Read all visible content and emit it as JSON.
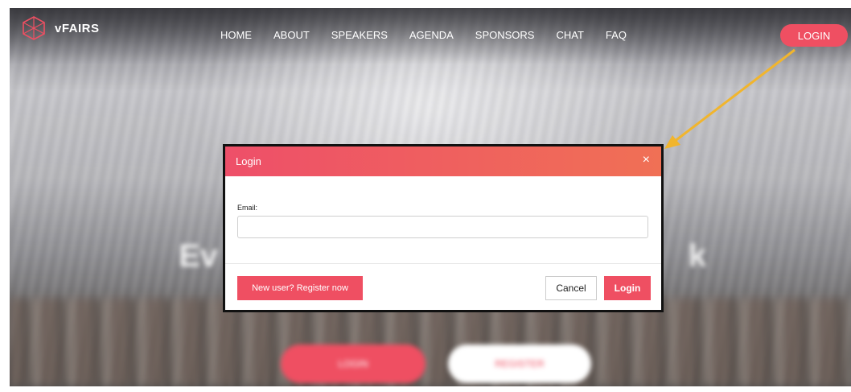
{
  "brand": {
    "name": "vFAIRS"
  },
  "nav": {
    "items": [
      "HOME",
      "ABOUT",
      "SPEAKERS",
      "AGENDA",
      "SPONSORS",
      "CHAT",
      "FAQ"
    ],
    "login_label": "LOGIN"
  },
  "hero": {
    "title_left": "Ev",
    "title_right": "k",
    "login_label": "LOGIN",
    "register_label": "REGISTER"
  },
  "modal": {
    "title": "Login",
    "close_glyph": "×",
    "email_label": "Email:",
    "email_value": "",
    "register_label": "New user? Register now",
    "cancel_label": "Cancel",
    "login_label": "Login"
  },
  "colors": {
    "accent": "#ef4f62",
    "arrow": "#f1b52d"
  }
}
